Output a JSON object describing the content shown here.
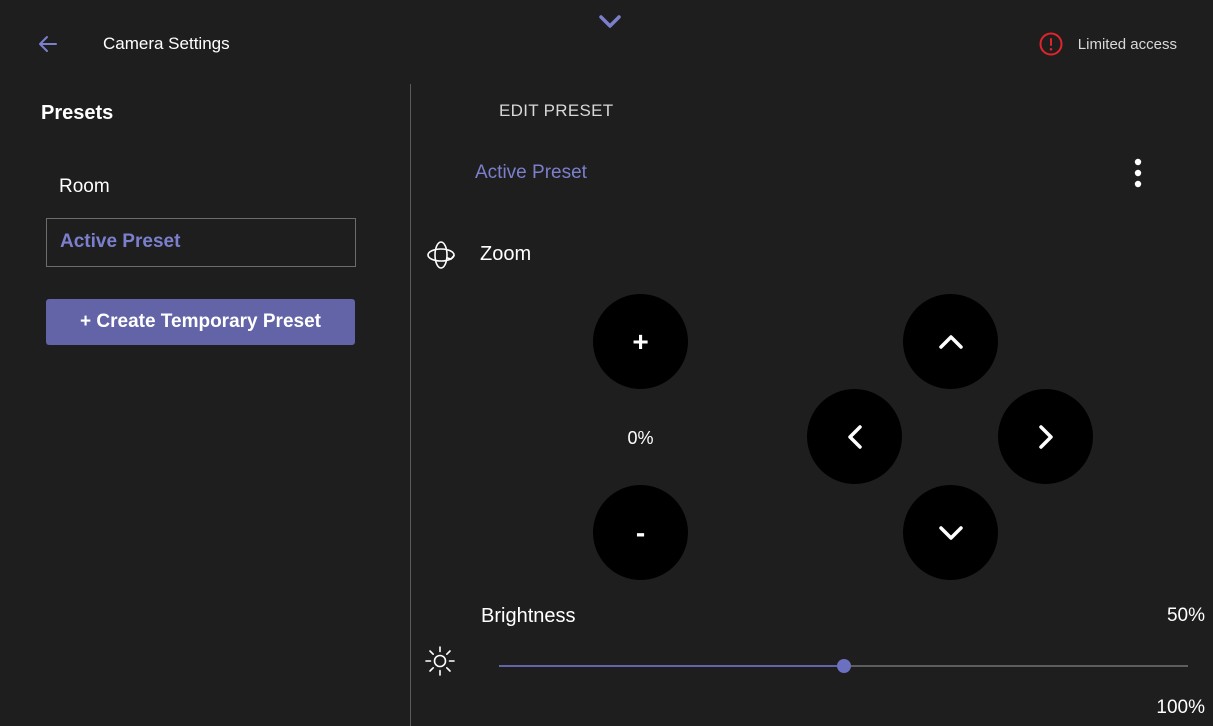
{
  "header": {
    "title": "Camera Settings",
    "status_text": "Limited access",
    "back_icon": "arrow-left-icon",
    "collapse_icon": "chevron-down-icon",
    "status_icon": "warning-circle-icon"
  },
  "colors": {
    "accent": "#6264a7",
    "accent_text": "#7b7fcc",
    "background": "#1e1e1e",
    "warning": "#e0242c"
  },
  "presets": {
    "heading": "Presets",
    "items": [
      {
        "label": "Room",
        "selected": false
      },
      {
        "label": "Active Preset",
        "selected": true
      }
    ],
    "create_button": "+ Create Temporary Preset"
  },
  "edit": {
    "heading": "EDIT PRESET",
    "preset_name": "Active Preset",
    "more_icon": "more-vertical-icon"
  },
  "zoom": {
    "label": "Zoom",
    "icon": "rotate-camera-icon",
    "zoom_in_label": "+",
    "zoom_out_label": "-",
    "value_text": "0%"
  },
  "pan": {
    "up_icon": "chevron-up-icon",
    "down_icon": "chevron-down-icon",
    "left_icon": "chevron-left-icon",
    "right_icon": "chevron-right-icon"
  },
  "brightness": {
    "label": "Brightness",
    "value_text": "50%",
    "max_text": "100%",
    "value": 50,
    "min": 0,
    "max": 100,
    "icon": "sun-icon"
  }
}
